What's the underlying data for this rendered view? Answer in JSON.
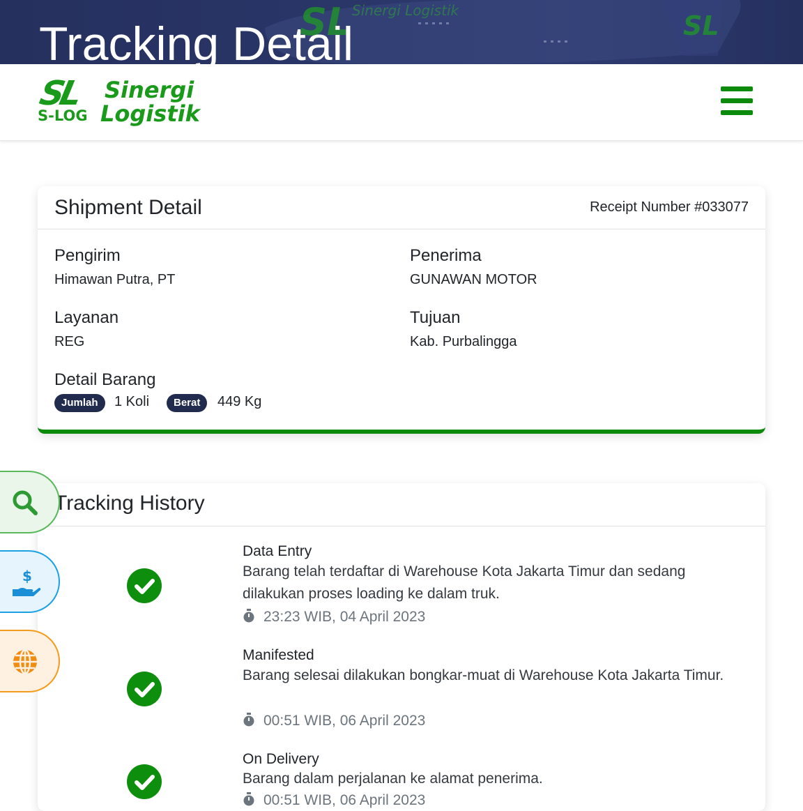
{
  "hero": {
    "title": "Tracking Detail",
    "plane_livery": "Sinergi Logistik"
  },
  "navbar": {
    "logo_mark": "SL",
    "logo_sub": "S-LOG",
    "logo_name_line1": "Sinergi",
    "logo_name_line2": "Logistik",
    "menu_icon": "hamburger-icon"
  },
  "shipment": {
    "title": "Shipment Detail",
    "receipt_number": "Receipt Number #033077",
    "sender_label": "Pengirim",
    "sender_value": "Himawan Putra, PT",
    "receiver_label": "Penerima",
    "receiver_value": "GUNAWAN MOTOR",
    "service_label": "Layanan",
    "service_value": "REG",
    "destination_label": "Tujuan",
    "destination_value": "Kab. Purbalingga",
    "goods_label": "Detail Barang",
    "qty_badge": "Jumlah",
    "qty_value": "1 Koli",
    "weight_badge": "Berat",
    "weight_value": "449 Kg"
  },
  "history": {
    "title": "Tracking History",
    "events": [
      {
        "status": "Data Entry",
        "description": "Barang telah terdaftar di Warehouse Kota Jakarta Timur dan sedang dilakukan proses loading ke dalam truk.",
        "time": "23:23 WIB, 04 April 2023"
      },
      {
        "status": "Manifested",
        "description": "Barang selesai dilakukan bongkar-muat di Warehouse Kota Jakarta Timur.",
        "time": "00:51 WIB, 06 April 2023"
      },
      {
        "status": "On Delivery",
        "description": "Barang dalam perjalanan ke alamat penerima.",
        "time": "00:51 WIB, 06 April 2023"
      }
    ]
  },
  "side_buttons": [
    {
      "icon": "search-icon",
      "color": "#58b85a"
    },
    {
      "icon": "hand-dollar-icon",
      "color": "#1ba1e6"
    },
    {
      "icon": "globe-icon",
      "color": "#f49b1b"
    }
  ],
  "colors": {
    "brand_green": "#0c8a0c",
    "hero_navy": "#25305e",
    "badge_navy": "#202b4d"
  }
}
